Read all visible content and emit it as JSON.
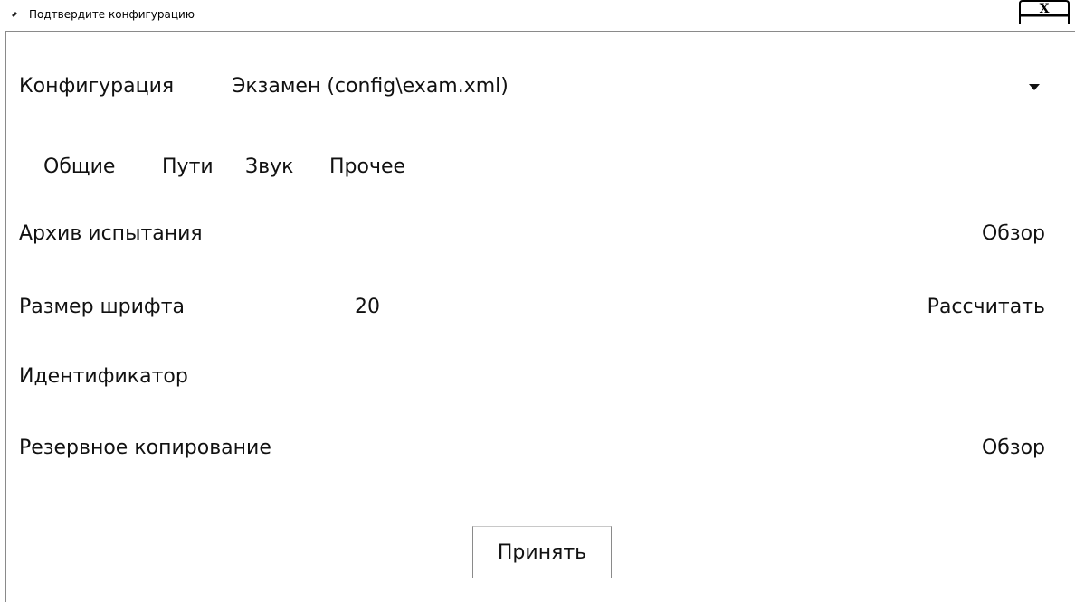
{
  "window": {
    "title": "Подтвердите конфигурацию",
    "close_symbol": "X"
  },
  "config": {
    "label": "Конфигурация",
    "value": "Экзамен (config\\exam.xml)"
  },
  "tabs": [
    {
      "label": "Общие"
    },
    {
      "label": "Пути"
    },
    {
      "label": "Звук"
    },
    {
      "label": "Прочее"
    }
  ],
  "fields": {
    "archive": {
      "label": "Архив испытания",
      "button": "Обзор"
    },
    "font_size": {
      "label": "Размер шрифта",
      "value": "20",
      "button": "Рассчитать"
    },
    "identifier": {
      "label": "Идентификатор",
      "value": ""
    },
    "backup": {
      "label": "Резервное копирование",
      "button": "Обзор"
    }
  },
  "footer": {
    "accept_label": "Принять"
  },
  "icons": {
    "app": "app-icon",
    "close": "close-icon",
    "dropdown": "chevron-down-icon"
  }
}
